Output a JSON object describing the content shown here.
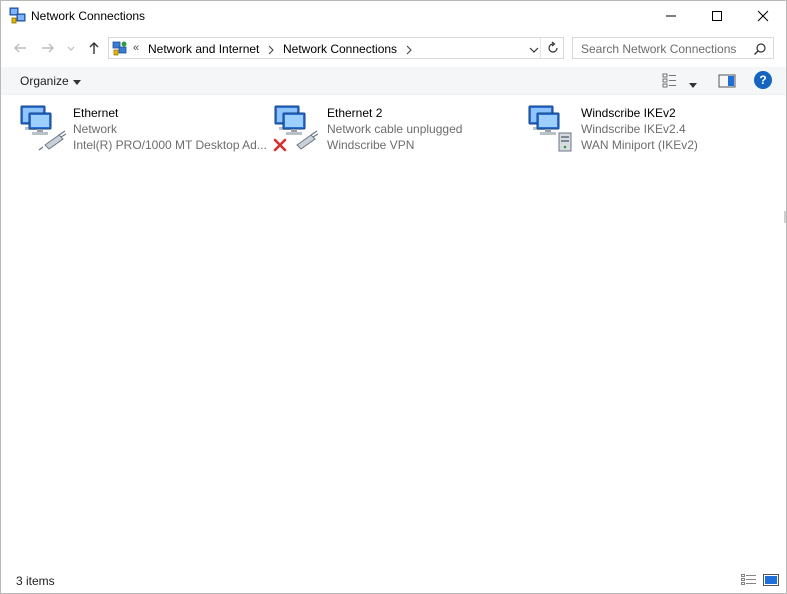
{
  "window": {
    "title": "Network Connections"
  },
  "address": {
    "prefix": "«",
    "breadcrumbs": [
      "Network and Internet",
      "Network Connections"
    ]
  },
  "search": {
    "placeholder": "Search Network Connections"
  },
  "toolbar": {
    "organize_label": "Organize",
    "help_label": "?"
  },
  "connections": [
    {
      "name": "Ethernet",
      "status": "Network",
      "device": "Intel(R) PRO/1000 MT Desktop Ad...",
      "icon": "ethernet-connection-icon",
      "disconnected": false
    },
    {
      "name": "Ethernet 2",
      "status": "Network cable unplugged",
      "device": "Windscribe VPN",
      "icon": "ethernet-disconnected-icon",
      "disconnected": true
    },
    {
      "name": "Windscribe IKEv2",
      "status": "Windscribe IKEv2.4",
      "device": "WAN Miniport (IKEv2)",
      "icon": "vpn-connection-icon",
      "disconnected": false
    }
  ],
  "status": {
    "item_count": "3 items"
  },
  "colors": {
    "accent": "#1565c0",
    "secondary_text": "#6d6d6d",
    "error_red": "#d32f2f"
  }
}
